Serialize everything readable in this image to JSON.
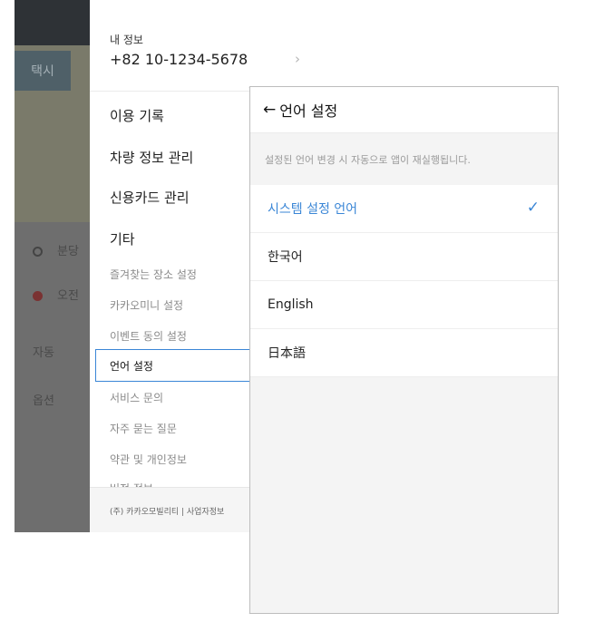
{
  "background_app": {
    "tab_label": "택시",
    "row1_label": "분당",
    "row2_label": "오전",
    "row3_label": "자동",
    "row4_label": "옵션"
  },
  "drawer": {
    "profile_label": "내 정보",
    "phone": "+82 10-1234-5678",
    "chevron": "›",
    "main_items": [
      "이용 기록",
      "차량 정보 관리",
      "신용카드 관리",
      "기타"
    ],
    "sub_items": [
      "즐겨찾는 장소 설정",
      "카카오미니 설정",
      "이벤트 동의 설정",
      "언어 설정",
      "서비스 문의",
      "자주 묻는 질문",
      "약관 및 개인정보",
      "버전 정보"
    ],
    "active_item": "언어 설정",
    "footer": "(주) 카카오모빌리티 | 사업자정보"
  },
  "language_screen": {
    "back_arrow": "←",
    "title": "언어 설정",
    "notice": "설정된 언어 변경 시 자동으로 앱이 재실행됩니다.",
    "options": [
      "시스템 설정 언어",
      "한국어",
      "English",
      "日本語"
    ],
    "selected": "시스템 설정 언어",
    "check_mark": "✓",
    "accent_color": "#3a86d6"
  }
}
